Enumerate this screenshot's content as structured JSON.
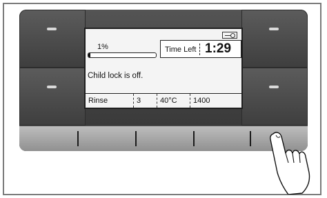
{
  "display": {
    "progress_label": "1%",
    "progress_value": 0.01,
    "time_left_label": "Time Left",
    "time_left_value": "1:29",
    "message": "Child lock is off.",
    "status": [
      "Rinse",
      "3",
      "40°C",
      "1400"
    ],
    "key_icon": "key-icon"
  },
  "buttons": {
    "top_left": "indicator-button",
    "bottom_left": "indicator-button",
    "top_right": "indicator-button",
    "bottom_right": "indicator-button",
    "softkey_count": 5
  },
  "colors": {
    "panel_dark": "#3e3e3e",
    "screen_bg": "#f4f4f4",
    "softkey_bar": "#a8a8a8"
  }
}
